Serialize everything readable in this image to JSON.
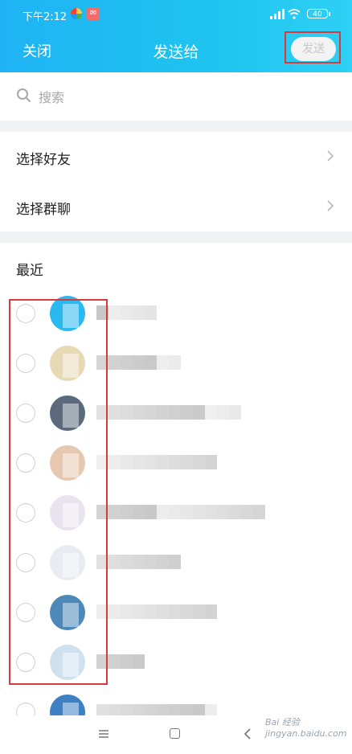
{
  "status_bar": {
    "time": "下午2:12",
    "battery": "40"
  },
  "header": {
    "close_label": "关闭",
    "title": "发送给",
    "send_label": "发送"
  },
  "search": {
    "placeholder": "搜索"
  },
  "menu": {
    "items": [
      {
        "label": "选择好友"
      },
      {
        "label": "选择群聊"
      }
    ]
  },
  "recent": {
    "title": "最近",
    "contacts": [
      {
        "avatar_color": "#2ab8f0"
      },
      {
        "avatar_color": "#e8d9b5"
      },
      {
        "avatar_color": "#5b6b7c"
      },
      {
        "avatar_color": "#e6c7b0"
      },
      {
        "avatar_color": "#e9e3ef"
      },
      {
        "avatar_color": "#e8ecf0"
      },
      {
        "avatar_color": "#4c88b8"
      },
      {
        "avatar_color": "#cfe0ee"
      },
      {
        "avatar_color": "#3f7fc4"
      }
    ]
  },
  "colors": {
    "header_gradient_start": "#1fb3f5",
    "header_gradient_end": "#2ed0f5",
    "highlight_red": "#d83a3a"
  },
  "watermark": "Bai 经验 jingyan.baidu.com"
}
